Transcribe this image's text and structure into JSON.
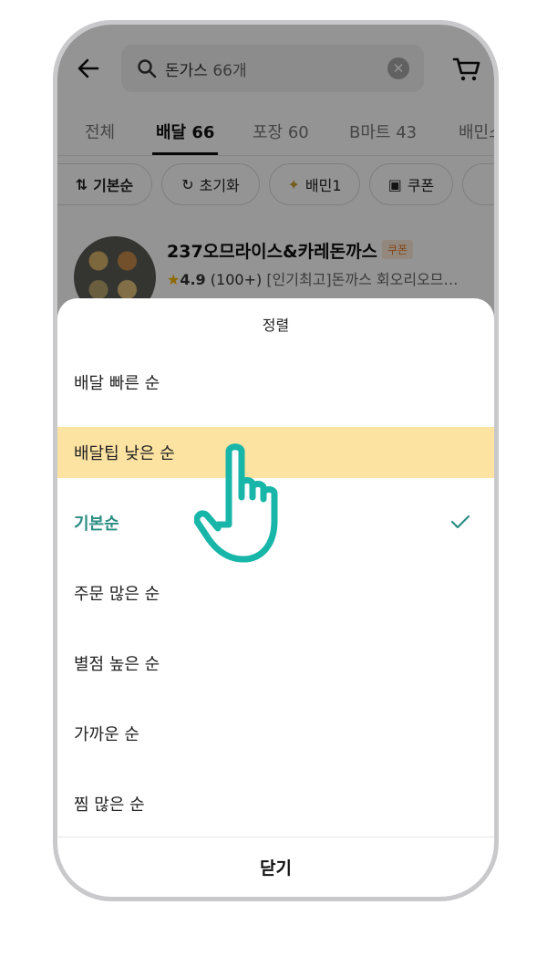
{
  "search": {
    "query": "돈가스",
    "count": "66개"
  },
  "tabs": [
    {
      "label": "전체"
    },
    {
      "label": "배달",
      "count": "66"
    },
    {
      "label": "포장 60"
    },
    {
      "label": "B마트 43"
    },
    {
      "label": "배민스"
    }
  ],
  "filters": {
    "sort": "기본순",
    "reset": "초기화",
    "baemin1": "배민1",
    "coupon": "쿠폰"
  },
  "store": {
    "name": "237오므라이스&카레돈까스",
    "badge": "쿠폰",
    "rating": "4.9",
    "reviews": "(100+)",
    "desc": "[인기최고]돈까스 회오리오므…"
  },
  "sheet": {
    "title": "정렬",
    "options": [
      {
        "label": "배달 빠른 순"
      },
      {
        "label": "배달팁 낮은 순"
      },
      {
        "label": "기본순"
      },
      {
        "label": "주문 많은 순"
      },
      {
        "label": "별점 높은 순"
      },
      {
        "label": "가까운 순"
      },
      {
        "label": "찜 많은 순"
      }
    ],
    "close": "닫기"
  },
  "colors": {
    "selected": "#2a8c83",
    "highlight": "#fde3a2",
    "hand_outline": "#18b6a8"
  },
  "icons": [
    "back-arrow-icon",
    "search-icon",
    "clear-icon",
    "cart-icon",
    "sort-icon",
    "refresh-icon",
    "coupon-icon",
    "checkmark-icon",
    "pointing-hand-icon"
  ]
}
